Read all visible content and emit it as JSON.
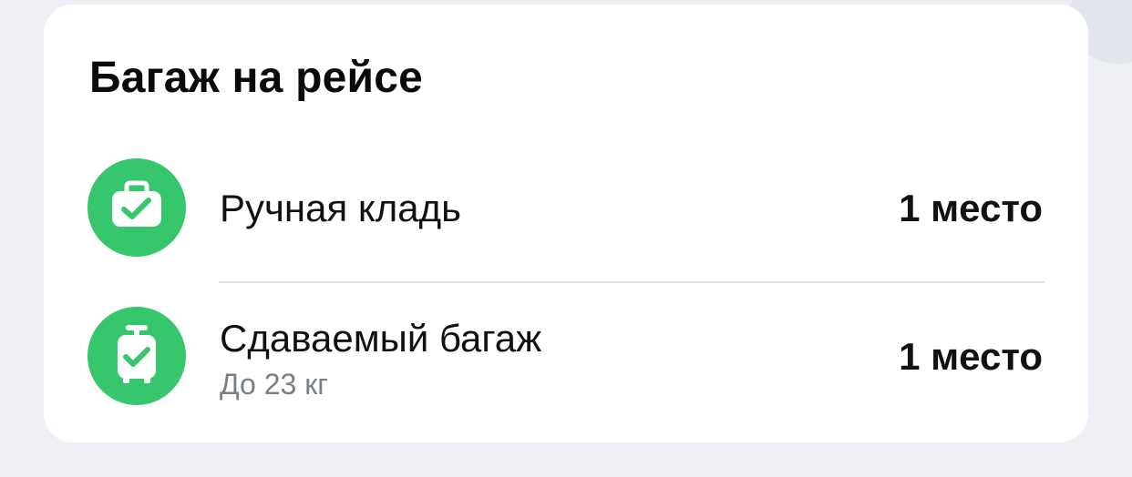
{
  "card": {
    "title": "Багаж на рейсе"
  },
  "items": [
    {
      "icon": "carry-on-bag-check-icon",
      "label": "Ручная кладь",
      "sublabel": "",
      "value": "1 место"
    },
    {
      "icon": "checked-suitcase-check-icon",
      "label": "Сдаваемый багаж",
      "sublabel": "До 23 кг",
      "value": "1 место"
    }
  ],
  "colors": {
    "accent_green": "#36c66b",
    "text_primary": "#111111",
    "text_secondary": "#7a7f87",
    "card_background": "#ffffff",
    "page_background": "#eef0f5"
  }
}
